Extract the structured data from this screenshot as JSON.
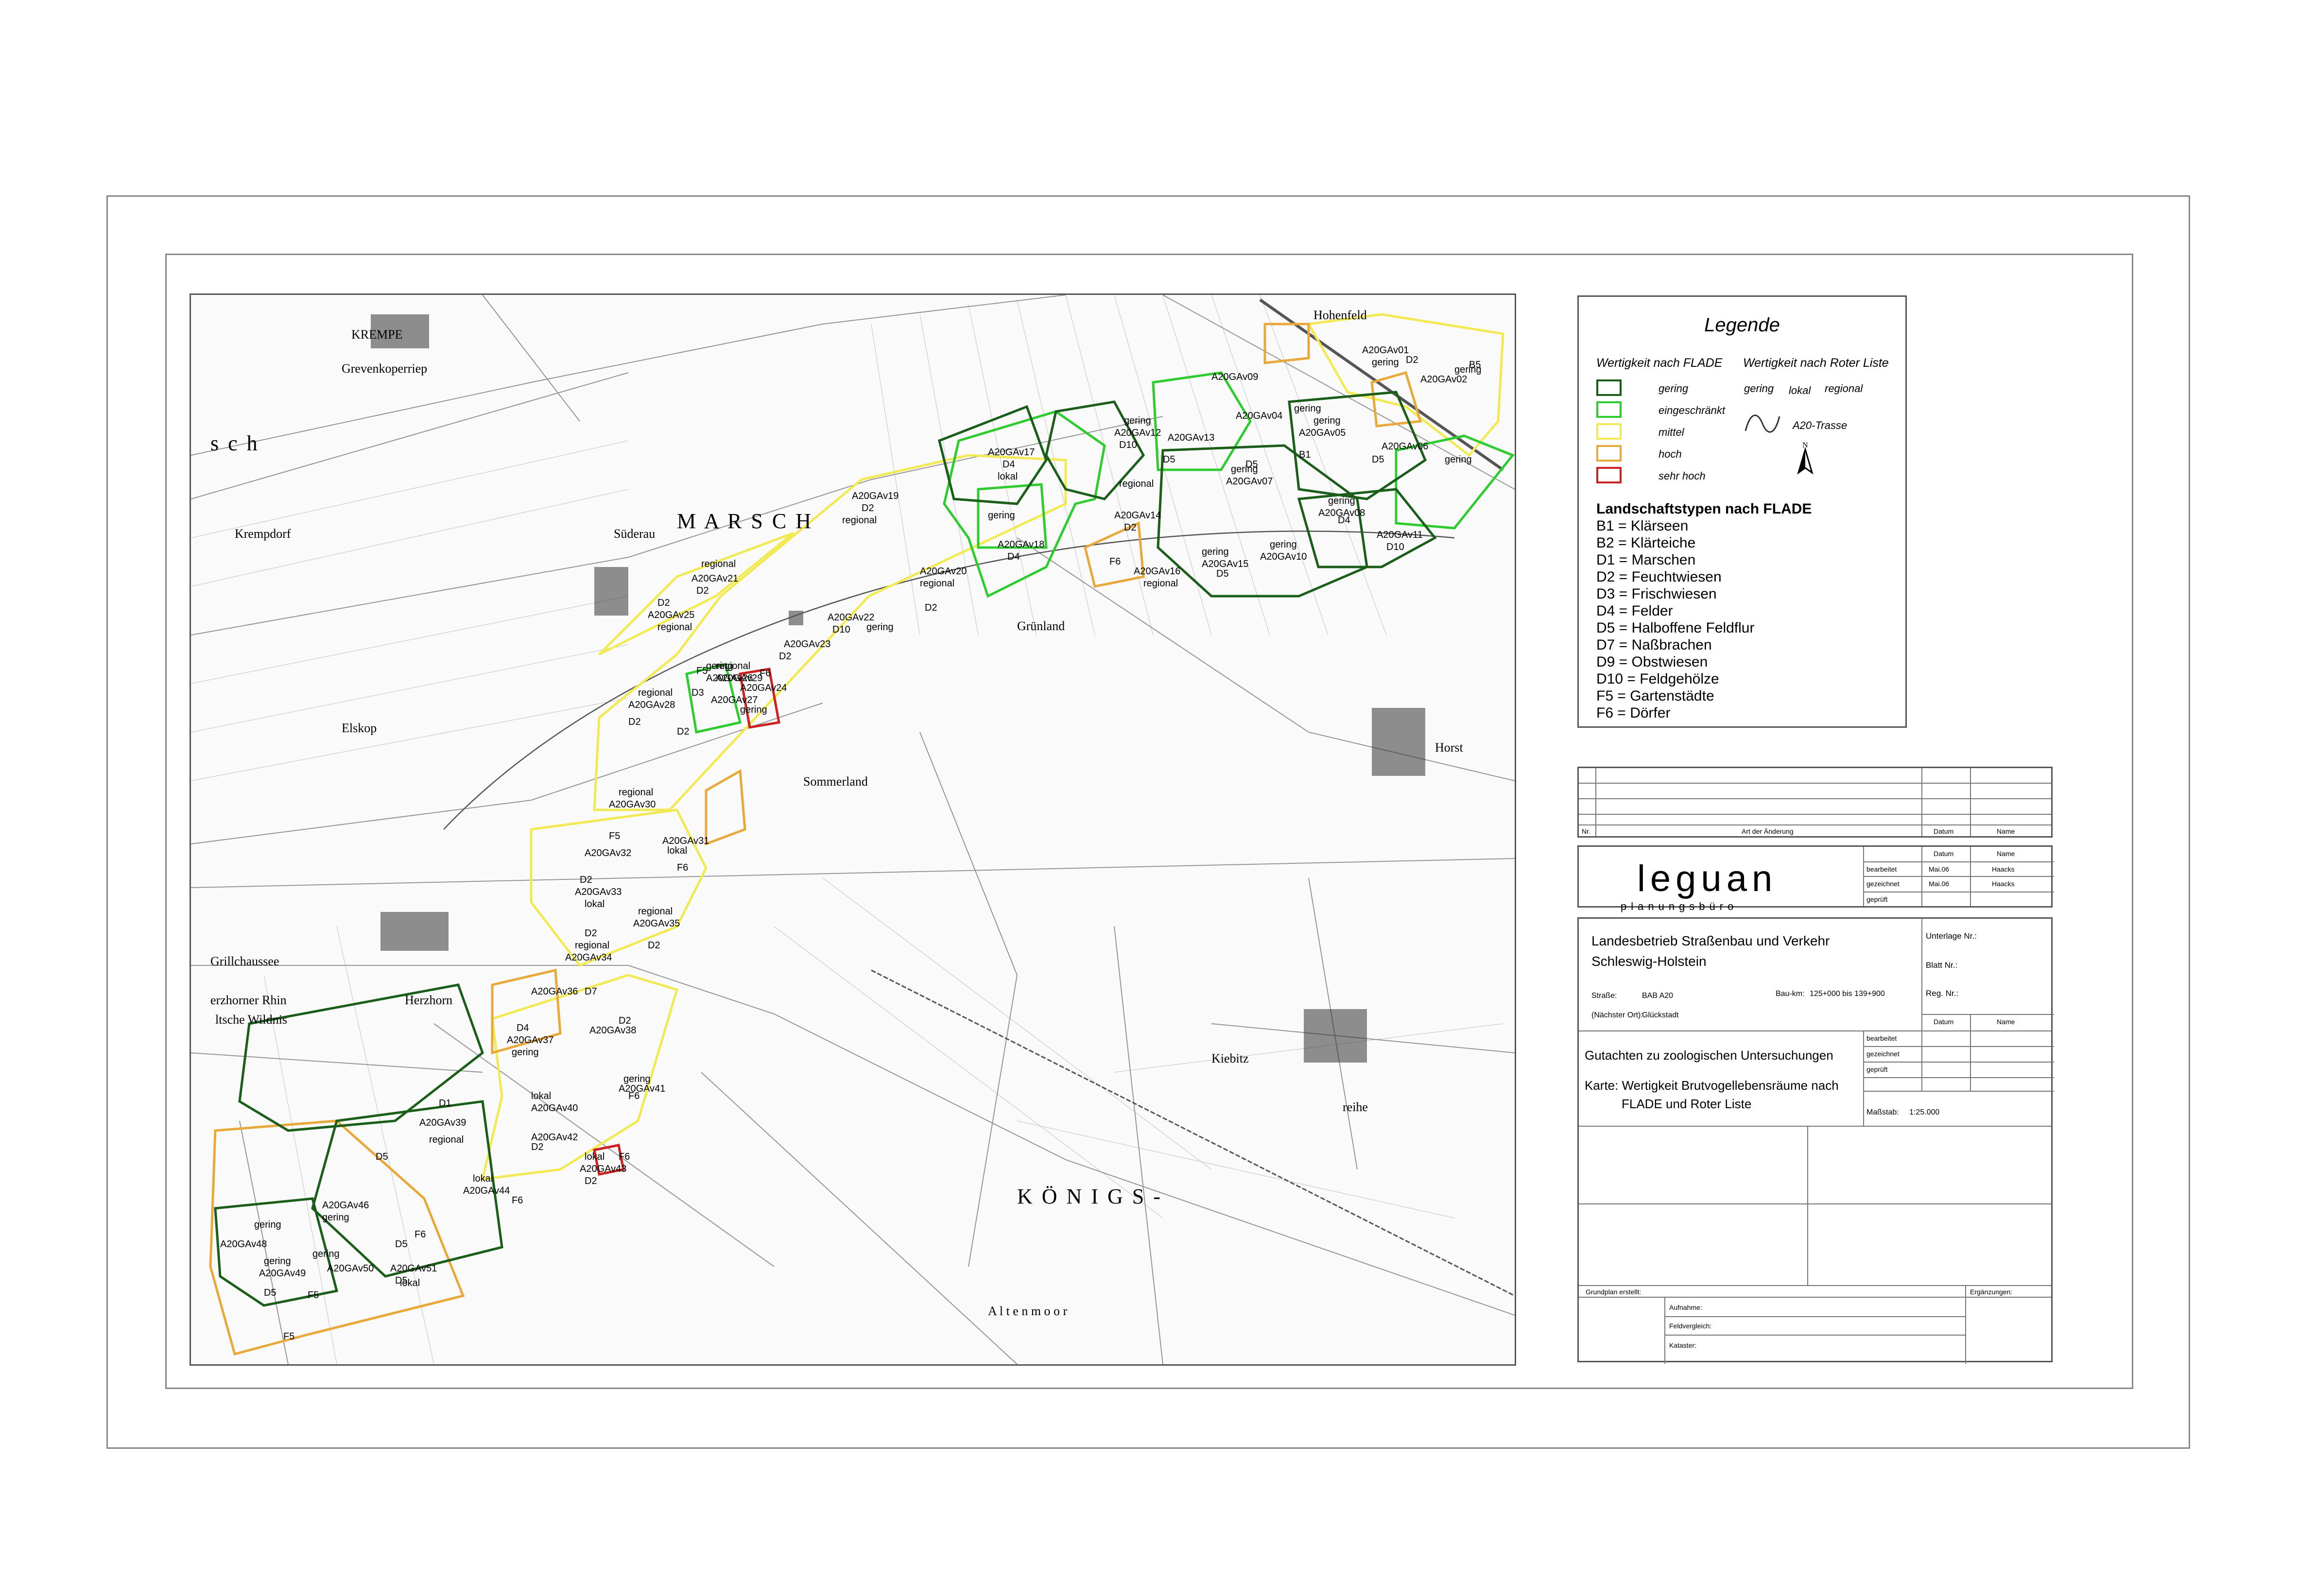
{
  "map": {
    "places": {
      "krempe": "KREMPE",
      "krempdorf": "Krempdorf",
      "suederau": "Süderau",
      "elskop": "Elskop",
      "sommerland": "Sommerland",
      "herzhorn": "Herzhorn",
      "grillchaussee": "Grillchaussee",
      "horst": "Horst",
      "hohenfeld": "Hohenfeld",
      "kiebitz": "Kiebitz",
      "reihe": "reihe",
      "koenigs": "K Ö N I G S -",
      "altenmoor": "A l t e n m o o r",
      "marsch": "M   A   R   S   C   H",
      "schleswig_left": "s     c     h",
      "gruenland": "Grünland",
      "wildnis": "ltsche Wildnis",
      "herzhorner_rhin": "erzhorner Rhin",
      "grevenkoperriep": "Grevenkoperriep"
    },
    "areas": [
      {
        "id": "A20GAv01",
        "value": "gering"
      },
      {
        "id": "A20GAv02",
        "value": "gering"
      },
      {
        "id": "A20GAv04",
        "value": "gering"
      },
      {
        "id": "A20GAv05",
        "value": "gering"
      },
      {
        "id": "A20GAv06",
        "value": "gering"
      },
      {
        "id": "A20GAv07",
        "value": "gering"
      },
      {
        "id": "A20GAv08",
        "value": "gering"
      },
      {
        "id": "A20GAv09",
        "value": ""
      },
      {
        "id": "A20GAv10",
        "value": "gering"
      },
      {
        "id": "A20GAv11",
        "value": ""
      },
      {
        "id": "A20GAv12",
        "value": "gering"
      },
      {
        "id": "A20GAv13",
        "value": ""
      },
      {
        "id": "A20GAv14",
        "value": "regional"
      },
      {
        "id": "A20GAv15",
        "value": "gering"
      },
      {
        "id": "A20GAv16",
        "value": "regional"
      },
      {
        "id": "A20GAv17",
        "value": "lokal"
      },
      {
        "id": "A20GAv18",
        "value": "gering"
      },
      {
        "id": "A20GAv19",
        "value": "regional"
      },
      {
        "id": "A20GAv20",
        "value": "regional"
      },
      {
        "id": "A20GAv21",
        "value": "regional"
      },
      {
        "id": "A20GAv22",
        "value": "gering"
      },
      {
        "id": "A20GAv23",
        "value": ""
      },
      {
        "id": "A20GAv24",
        "value": ""
      },
      {
        "id": "A20GAv25",
        "value": "regional"
      },
      {
        "id": "A20GAv26",
        "value": "gering"
      },
      {
        "id": "A20GAv27",
        "value": "gering"
      },
      {
        "id": "A20GAv28",
        "value": "regional"
      },
      {
        "id": "A20GAv29",
        "value": "regional"
      },
      {
        "id": "A20GAv30",
        "value": "regional"
      },
      {
        "id": "A20GAv31",
        "value": "lokal"
      },
      {
        "id": "A20GAv32",
        "value": ""
      },
      {
        "id": "A20GAv33",
        "value": "lokal"
      },
      {
        "id": "A20GAv34",
        "value": "regional"
      },
      {
        "id": "A20GAv35",
        "value": "regional"
      },
      {
        "id": "A20GAv36",
        "value": ""
      },
      {
        "id": "A20GAv37",
        "value": "gering"
      },
      {
        "id": "A20GAv38",
        "value": ""
      },
      {
        "id": "A20GAv39",
        "value": "regional"
      },
      {
        "id": "A20GAv40",
        "value": "lokal"
      },
      {
        "id": "A20GAv41",
        "value": "gering"
      },
      {
        "id": "A20GAv42",
        "value": ""
      },
      {
        "id": "A20GAv43",
        "value": "lokal"
      },
      {
        "id": "A20GAv44",
        "value": "lokal"
      },
      {
        "id": "A20GAv46",
        "value": "gering"
      },
      {
        "id": "A20GAv48",
        "value": "gering"
      },
      {
        "id": "A20GAv49",
        "value": "gering"
      },
      {
        "id": "A20GAv50",
        "value": "gering"
      },
      {
        "id": "A20GAv51",
        "value": "lokal"
      }
    ],
    "type_codes": [
      "D1",
      "D2",
      "D3",
      "D4",
      "D5",
      "D10",
      "B1",
      "B5",
      "F5",
      "F6",
      "D7"
    ]
  },
  "legend": {
    "title": "Legende",
    "col1_head": "Wertigkeit nach FLADE",
    "col2_head": "Wertigkeit nach Roter Liste",
    "flade_classes": [
      {
        "label": "gering",
        "color": "#1a5e1a"
      },
      {
        "label": "eingeschränkt",
        "color": "#2ecc2e"
      },
      {
        "label": "mittel",
        "color": "#f2ea55"
      },
      {
        "label": "hoch",
        "color": "#e8a93a"
      },
      {
        "label": "sehr hoch",
        "color": "#cc2222"
      }
    ],
    "roter_liste": [
      "gering",
      "lokal",
      "regional"
    ],
    "trasse": "A20-Trasse",
    "north": "N",
    "types_title": "Landschaftstypen nach FLADE",
    "types": [
      "B1 = Klärseen",
      "B2 = Klärteiche",
      "D1 = Marschen",
      "D2 = Feuchtwiesen",
      "D3 = Frischwiesen",
      "D4 = Felder",
      "D5 = Halboffene Feldflur",
      "D7 = Naßbrachen",
      "D9 = Obstwiesen",
      "D10 = Feldgehölze",
      "F5 = Gartenstädte",
      "F6 = Dörfer"
    ]
  },
  "change_table": {
    "nr": "Nr.",
    "art": "Art der Änderung",
    "datum": "Datum",
    "name": "Name"
  },
  "logo": {
    "name": "leguan",
    "sub": "planungsbüro",
    "col_datum": "Datum",
    "col_name": "Name",
    "rows": [
      {
        "label": "bearbeitet",
        "date": "Mai.06",
        "name": "Haacks"
      },
      {
        "label": "gezeichnet",
        "date": "Mai.06",
        "name": "Haacks"
      },
      {
        "label": "geprüft",
        "date": "",
        "name": ""
      }
    ]
  },
  "title_block": {
    "org": "Landesbetrieb Straßenbau und Verkehr",
    "org2": "Schleswig-Holstein",
    "strasse_label": "Straße:",
    "strasse": "BAB A20",
    "ort_label": "(Nächster Ort):",
    "ort": "Glückstadt",
    "baukm_label": "Bau-km:",
    "baukm": "125+000 bis 139+900",
    "unterlage": "Unterlage Nr.:",
    "blatt": "Blatt Nr.:",
    "reg": "Reg. Nr.:",
    "datum": "Datum",
    "name": "Name",
    "gutachten": "Gutachten zu zoologischen Untersuchungen",
    "karte": "Karte: Wertigkeit Brutvogellebensräume nach",
    "karte2": "FLADE und Roter Liste",
    "sign": [
      "bearbeitet",
      "gezeichnet",
      "geprüft"
    ],
    "massstab_label": "Maßstab:",
    "massstab": "1:25.000",
    "grundplan": "Grundplan erstellt:",
    "ergaenzungen": "Ergänzungen:",
    "aufnahme": "Aufnahme:",
    "feldvergleich": "Feldvergleich:",
    "kataster": "Kataster:"
  }
}
